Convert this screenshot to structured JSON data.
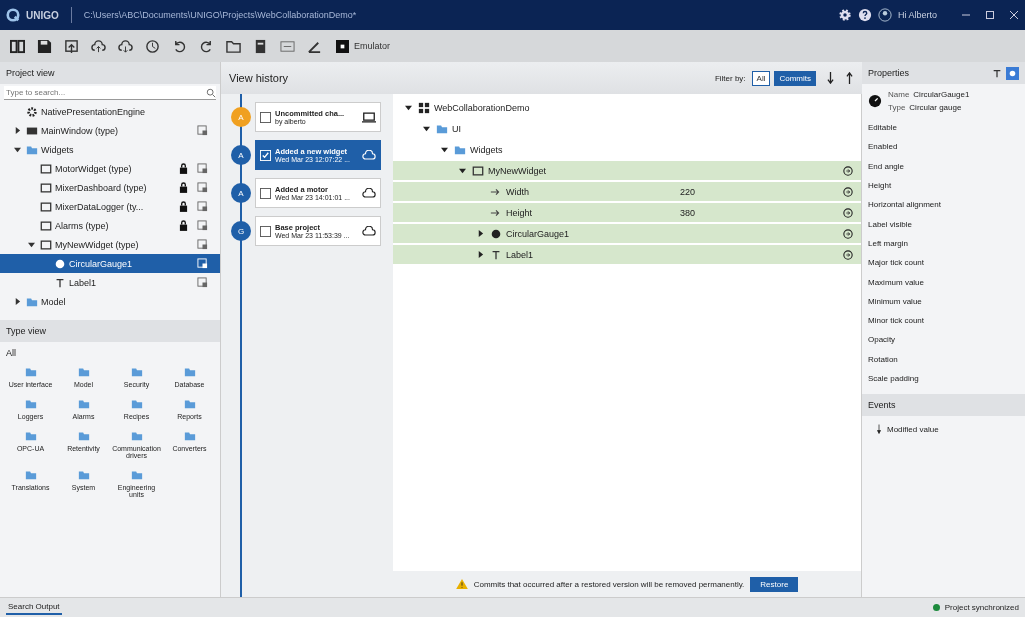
{
  "title_bar": {
    "app_name": "UNIGO",
    "path": "C:\\Users\\ABC\\Documents\\UNIGO\\Projects\\WebCollaborationDemo*",
    "user": "Hi Alberto"
  },
  "toolbar": {
    "emulator": "Emulator"
  },
  "project_view": {
    "title": "Project view",
    "search_placeholder": "Type to search...",
    "tree": [
      {
        "label": "NativePresentationEngine",
        "kind": "engine",
        "selected": false,
        "locked": false
      },
      {
        "label": "MainWindow (type)",
        "kind": "window",
        "expanded": false,
        "selected": false,
        "locked": false
      },
      {
        "label": "Widgets",
        "kind": "folder",
        "expanded": true,
        "selected": false,
        "locked": false,
        "children": [
          {
            "label": "MotorWidget (type)",
            "kind": "widget",
            "selected": false,
            "locked": true
          },
          {
            "label": "MixerDashboard (type)",
            "kind": "widget",
            "selected": false,
            "locked": true
          },
          {
            "label": "MixerDataLogger (ty...",
            "kind": "widget",
            "selected": false,
            "locked": true
          },
          {
            "label": "Alarms (type)",
            "kind": "widget",
            "selected": false,
            "locked": true
          },
          {
            "label": "MyNewWidget (type)",
            "kind": "widget",
            "expanded": true,
            "selected": false,
            "locked": false,
            "children": [
              {
                "label": "CircularGauge1",
                "kind": "gauge",
                "selected": true,
                "locked": false
              },
              {
                "label": "Label1",
                "kind": "label",
                "selected": false,
                "locked": false
              }
            ]
          }
        ]
      },
      {
        "label": "Model",
        "kind": "folder",
        "expanded": false,
        "selected": false,
        "locked": false
      }
    ]
  },
  "type_view": {
    "title": "Type view",
    "filter": "All",
    "items": [
      "User interface",
      "Model",
      "Security",
      "Database",
      "Loggers",
      "Alarms",
      "Recipes",
      "Reports",
      "OPC-UA",
      "Retentivity",
      "Communication drivers",
      "Converters",
      "Translations",
      "System",
      "Engineering units"
    ]
  },
  "history": {
    "title": "View history",
    "filter_label": "Filter by:",
    "filters": [
      {
        "label": "All",
        "selected": false
      },
      {
        "label": "Commits",
        "selected": true
      }
    ],
    "entries": [
      {
        "badge": "A",
        "color": "#f0a020",
        "title": "Uncommitted cha...",
        "subtitle": "by alberto",
        "kind": "local",
        "checked": false,
        "selected": false
      },
      {
        "badge": "A",
        "color": "#1f5fa8",
        "title": "Added a new widget",
        "subtitle": "Wed Mar 23 12:07:22 ...",
        "kind": "cloud",
        "checked": true,
        "selected": true
      },
      {
        "badge": "A",
        "color": "#1f5fa8",
        "title": "Added a motor",
        "subtitle": "Wed Mar 23 14:01:01 ...",
        "kind": "cloud",
        "checked": false,
        "selected": false
      },
      {
        "badge": "G",
        "color": "#1f5fa8",
        "title": "Base project",
        "subtitle": "Wed Mar 23 11:53:39 ...",
        "kind": "cloud",
        "checked": false,
        "selected": false
      }
    ]
  },
  "compare": {
    "tree": [
      {
        "label": "WebCollaborationDemo",
        "kind": "project",
        "expanded": true,
        "changed": false,
        "children": [
          {
            "label": "UI",
            "kind": "folder",
            "expanded": true,
            "changed": false,
            "children": [
              {
                "label": "Widgets",
                "kind": "folder",
                "expanded": true,
                "changed": false,
                "children": [
                  {
                    "label": "MyNewWidget",
                    "kind": "widget",
                    "expanded": true,
                    "changed": true,
                    "children": [
                      {
                        "label": "Width",
                        "kind": "property",
                        "value": "220",
                        "changed": true
                      },
                      {
                        "label": "Height",
                        "kind": "property",
                        "value": "380",
                        "changed": true
                      },
                      {
                        "label": "CircularGauge1",
                        "kind": "gauge",
                        "expanded": false,
                        "changed": true
                      },
                      {
                        "label": "Label1",
                        "kind": "label",
                        "expanded": false,
                        "changed": true
                      }
                    ]
                  }
                ]
              }
            ]
          }
        ]
      }
    ],
    "notice": "Commits that occurred after a restored version will be removed permanently.",
    "restore": "Restore"
  },
  "properties": {
    "title": "Properties",
    "name_label": "Name",
    "name": "CircularGauge1",
    "type_label": "Type",
    "type": "Circular gauge",
    "items": [
      "Editable",
      "Enabled",
      "End angle",
      "Height",
      "Horizontal alignment",
      "Label visible",
      "Left margin",
      "Major tick count",
      "Maximum value",
      "Minimum value",
      "Minor tick count",
      "Opacity",
      "Rotation",
      "Scale padding"
    ],
    "events_title": "Events",
    "events": [
      "Modified value"
    ]
  },
  "status_bar": {
    "tab": "Search Output",
    "sync": "Project synchronized"
  }
}
